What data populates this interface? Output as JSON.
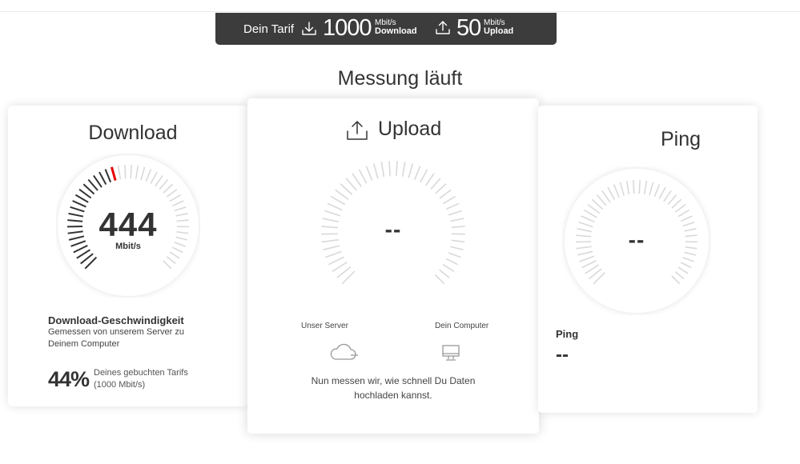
{
  "tarif": {
    "label": "Dein Tarif",
    "download_value": "1000",
    "download_unit": "Mbit/s",
    "download_word": "Download",
    "upload_value": "50",
    "upload_unit": "Mbit/s",
    "upload_word": "Upload"
  },
  "status": "Messung läuft",
  "download": {
    "title": "Download",
    "value": "444",
    "unit": "Mbit/s",
    "gauge_fraction": 0.444,
    "desc_title": "Download-Geschwindigkeit",
    "desc_sub": "Gemessen von unserem Server zu Deinem Computer",
    "percent": "44%",
    "percent_note_1": "Deines gebuchten Tarifs",
    "percent_note_2": "(1000 Mbit/s)"
  },
  "upload": {
    "title": "Upload",
    "value": "--",
    "server_label": "Unser Server",
    "computer_label": "Dein Computer",
    "info_1": "Nun messen wir, wie schnell Du Daten",
    "info_2": "hochladen kannst."
  },
  "ping": {
    "title": "Ping",
    "value": "--",
    "label": "Ping",
    "result": "--"
  },
  "colors": {
    "accent": "#e60000",
    "tarif_bar": "#3c3c3c",
    "text": "#333333",
    "tick_inactive": "#d9d9d9",
    "tick_active": "#333333"
  },
  "icons": [
    "download-arrow-icon",
    "upload-arrow-icon",
    "cloud-icon",
    "monitor-icon"
  ]
}
